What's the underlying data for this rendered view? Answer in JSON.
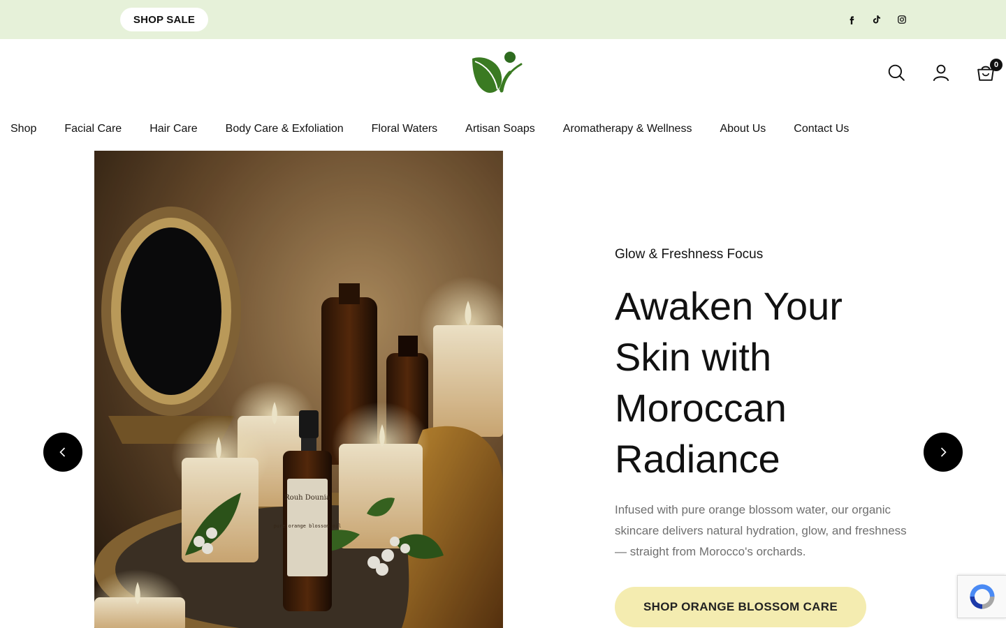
{
  "topbar": {
    "sale_label": "SHOP SALE",
    "social": [
      "facebook-icon",
      "tiktok-icon",
      "instagram-icon"
    ]
  },
  "header": {
    "logo": "leaf-logo",
    "icons": [
      "search-icon",
      "account-icon",
      "cart-icon"
    ],
    "cart_count": "0"
  },
  "nav": {
    "items": [
      {
        "label": "Shop"
      },
      {
        "label": "Facial Care"
      },
      {
        "label": "Hair Care"
      },
      {
        "label": "Body Care & Exfoliation"
      },
      {
        "label": "Floral Waters"
      },
      {
        "label": "Artisan Soaps"
      },
      {
        "label": "Aromatherapy & Wellness"
      },
      {
        "label": "About Us"
      },
      {
        "label": "Contact Us"
      }
    ]
  },
  "hero": {
    "eyebrow": "Glow & Freshness Focus",
    "headline": "Awaken Your Skin with Moroccan Radiance",
    "description": "Infused with pure orange blossom water, our organic skincare delivers natural hydration, glow, and freshness — straight from Morocco's orchards.",
    "cta_label": "SHOP ORANGE BLOSSOM CARE",
    "product_label": {
      "brand": "Rouh Dounia",
      "name": "pure orange blossom oil"
    }
  },
  "colors": {
    "topbar_bg": "#e6f1d9",
    "cta_bg": "#f4ecb0",
    "brand_green": "#2e6b1f",
    "text_muted": "#6f6f6f"
  }
}
